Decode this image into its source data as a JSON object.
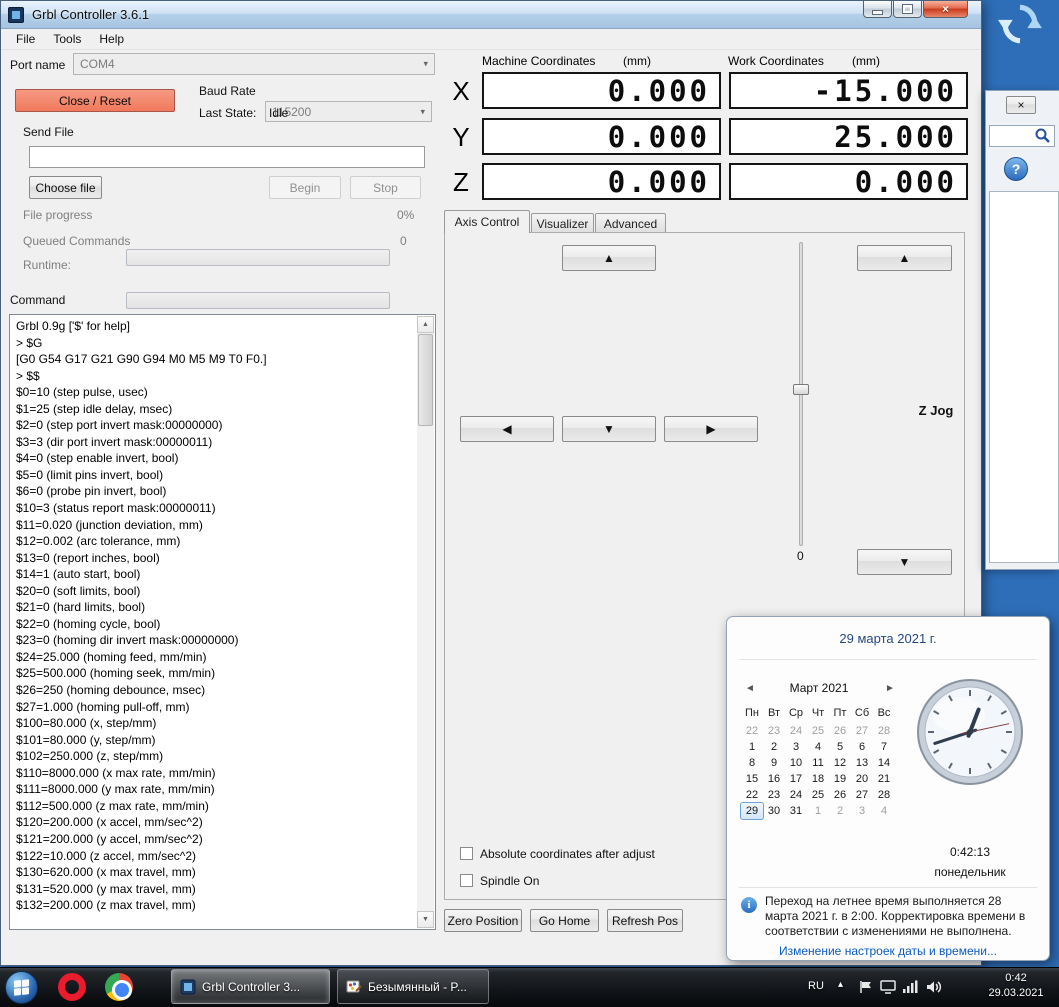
{
  "icons": {
    "jog_up": "▲",
    "jog_down": "▼",
    "jog_left": "◀",
    "jog_right": "▶",
    "combo_arrow": "▾",
    "scroll_up": "▲",
    "scroll_down": "▼",
    "cal_prev": "◄",
    "cal_next": "►",
    "tray_chevron": "▴",
    "close_x": "×",
    "info_i": "i",
    "help_q": "?"
  },
  "colors": {
    "desktop": "#2e6db8",
    "close_reset_accent": "#f0795b",
    "selection_blue": "#6fa1d4"
  },
  "app": {
    "title": "Grbl Controller 3.6.1",
    "menu": {
      "file": "File",
      "tools": "Tools",
      "help": "Help"
    },
    "connection": {
      "port_label": "Port name",
      "port_value": "COM4",
      "close_reset_label": "Close / Reset",
      "baud_label": "Baud Rate",
      "baud_value": "115200",
      "last_state_label": "Last State:",
      "last_state_value": "Idle"
    },
    "send_file": {
      "section_label": "Send File",
      "filename_value": "",
      "choose_file_label": "Choose file",
      "begin_label": "Begin",
      "stop_label": "Stop",
      "file_progress_label": "File progress",
      "file_progress_text": "0%",
      "file_progress_percent": 0,
      "queued_label": "Queued Commands",
      "queued_text": "0",
      "runtime_label": "Runtime:"
    },
    "command": {
      "label": "Command",
      "value": ""
    },
    "console": {
      "lines": [
        "Grbl 0.9g ['$' for help]",
        "> $G",
        "[G0 G54 G17 G21 G90 G94 M0 M5 M9 T0 F0.]",
        "> $$",
        "$0=10 (step pulse, usec)",
        "$1=25 (step idle delay, msec)",
        "$2=0 (step port invert mask:00000000)",
        "$3=3 (dir port invert mask:00000011)",
        "$4=0 (step enable invert, bool)",
        "$5=0 (limit pins invert, bool)",
        "$6=0 (probe pin invert, bool)",
        "$10=3 (status report mask:00000011)",
        "$11=0.020 (junction deviation, mm)",
        "$12=0.002 (arc tolerance, mm)",
        "$13=0 (report inches, bool)",
        "$14=1 (auto start, bool)",
        "$20=0 (soft limits, bool)",
        "$21=0 (hard limits, bool)",
        "$22=0 (homing cycle, bool)",
        "$23=0 (homing dir invert mask:00000000)",
        "$24=25.000 (homing feed, mm/min)",
        "$25=500.000 (homing seek, mm/min)",
        "$26=250 (homing debounce, msec)",
        "$27=1.000 (homing pull-off, mm)",
        "$100=80.000 (x, step/mm)",
        "$101=80.000 (y, step/mm)",
        "$102=250.000 (z, step/mm)",
        "$110=8000.000 (x max rate, mm/min)",
        "$111=8000.000 (y max rate, mm/min)",
        "$112=500.000 (z max rate, mm/min)",
        "$120=200.000 (x accel, mm/sec^2)",
        "$121=200.000 (y accel, mm/sec^2)",
        "$122=10.000 (z accel, mm/sec^2)",
        "$130=620.000 (x max travel, mm)",
        "$131=520.000 (y max travel, mm)",
        "$132=200.000 (z max travel, mm)"
      ]
    },
    "coordinates": {
      "machine_header": "Machine Coordinates",
      "machine_units": "(mm)",
      "work_header": "Work Coordinates",
      "work_units": "(mm)",
      "axes": [
        {
          "axis": "X",
          "machine": "0.000",
          "work": "-15.000"
        },
        {
          "axis": "Y",
          "machine": "0.000",
          "work": "25.000"
        },
        {
          "axis": "Z",
          "machine": "0.000",
          "work": "0.000"
        }
      ]
    },
    "tabs": {
      "axis_control": "Axis Control",
      "visualizer": "Visualizer",
      "advanced": "Advanced"
    },
    "axis_panel": {
      "z_jog_label": "Z Jog",
      "slider_value": "0",
      "absolute_checkbox_label": "Absolute coordinates after adjust",
      "absolute_checked": false,
      "spindle_checkbox_label": "Spindle On",
      "spindle_checked": false,
      "zero_position_label": "Zero Position",
      "go_home_label": "Go Home",
      "refresh_pos_label": "Refresh Pos"
    }
  },
  "clock_flyout": {
    "date_title": "29 марта 2021 г.",
    "month_title": "Март 2021",
    "weekdays": [
      "Пн",
      "Вт",
      "Ср",
      "Чт",
      "Пт",
      "Сб",
      "Вс"
    ],
    "days": [
      {
        "d": "22",
        "muted": true
      },
      {
        "d": "23",
        "muted": true
      },
      {
        "d": "24",
        "muted": true
      },
      {
        "d": "25",
        "muted": true
      },
      {
        "d": "26",
        "muted": true
      },
      {
        "d": "27",
        "muted": true
      },
      {
        "d": "28",
        "muted": true
      },
      {
        "d": "1"
      },
      {
        "d": "2"
      },
      {
        "d": "3"
      },
      {
        "d": "4"
      },
      {
        "d": "5"
      },
      {
        "d": "6"
      },
      {
        "d": "7"
      },
      {
        "d": "8"
      },
      {
        "d": "9"
      },
      {
        "d": "10"
      },
      {
        "d": "11"
      },
      {
        "d": "12"
      },
      {
        "d": "13"
      },
      {
        "d": "14"
      },
      {
        "d": "15"
      },
      {
        "d": "16"
      },
      {
        "d": "17"
      },
      {
        "d": "18"
      },
      {
        "d": "19"
      },
      {
        "d": "20"
      },
      {
        "d": "21"
      },
      {
        "d": "22"
      },
      {
        "d": "23"
      },
      {
        "d": "24"
      },
      {
        "d": "25"
      },
      {
        "d": "26"
      },
      {
        "d": "27"
      },
      {
        "d": "28"
      },
      {
        "d": "29",
        "selected": true
      },
      {
        "d": "30"
      },
      {
        "d": "31"
      },
      {
        "d": "1",
        "muted": true
      },
      {
        "d": "2",
        "muted": true
      },
      {
        "d": "3",
        "muted": true
      },
      {
        "d": "4",
        "muted": true
      }
    ],
    "time_text": "0:42:13",
    "weekday_name": "понедельник",
    "analog_time": {
      "hours": 0,
      "minutes": 42,
      "seconds": 13
    },
    "dst_notice": "Переход на летнее время выполняется 28 марта 2021 г. в 2:00. Корректировка времени в соответствии с изменениями не выполнена.",
    "settings_link": "Изменение настроек даты и времени..."
  },
  "taskbar": {
    "buttons": [
      {
        "label": "Grbl Controller 3...",
        "active": true
      },
      {
        "label": "Безымянный - P...",
        "active": false
      }
    ],
    "tray": {
      "lang": "RU",
      "time": "0:42",
      "date": "29.03.2021"
    }
  }
}
